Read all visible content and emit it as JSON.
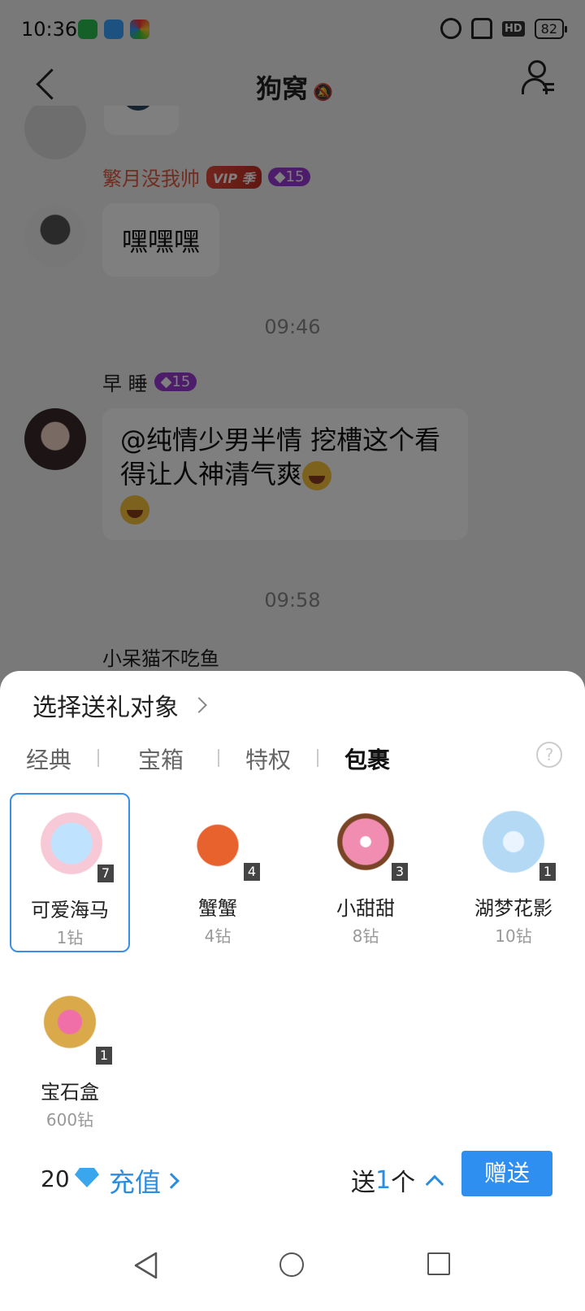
{
  "status_bar": {
    "time": "10:36",
    "hd": "HD",
    "battery": "82"
  },
  "nav": {
    "title": "狗窝"
  },
  "chat": {
    "messages": [
      {
        "sender": "繁月没我帅",
        "vip": "VIP",
        "vip_suffix": "季",
        "level": "15",
        "text": "嘿嘿嘿"
      },
      {
        "sender": "早 睡",
        "level": "15",
        "text": "@纯情少男半情 挖槽这个看得让人神清气爽"
      },
      {
        "sender": "小呆猫不吃鱼"
      }
    ],
    "timestamps": [
      "09:46",
      "09:58"
    ]
  },
  "gift_panel": {
    "select_target": "选择送礼对象",
    "tabs": [
      {
        "label": "经典",
        "active": false
      },
      {
        "label": "宝箱",
        "active": false
      },
      {
        "label": "特权",
        "active": false
      },
      {
        "label": "包裹",
        "active": true
      }
    ],
    "help": "?",
    "gifts": [
      {
        "name": "可爱海马",
        "price": "1钻",
        "count": "7",
        "icon": "seahorse-icon",
        "selected": true
      },
      {
        "name": "蟹蟹",
        "price": "4钻",
        "count": "4",
        "icon": "crab-icon",
        "selected": false
      },
      {
        "name": "小甜甜",
        "price": "8钻",
        "count": "3",
        "icon": "donut-icon",
        "selected": false
      },
      {
        "name": "湖梦花影",
        "price": "10钻",
        "count": "1",
        "icon": "flower-orb-icon",
        "selected": false
      },
      {
        "name": "宝石盒",
        "price": "600钻",
        "count": "1",
        "icon": "gem-box-icon",
        "selected": false
      }
    ],
    "balance": "20",
    "recharge_label": "充值",
    "send_prefix": "送",
    "send_count": "1",
    "send_suffix": "个",
    "give_label": "赠送"
  },
  "colors": {
    "accent": "#2f8ff0",
    "selected_border": "#3a8fe8"
  }
}
